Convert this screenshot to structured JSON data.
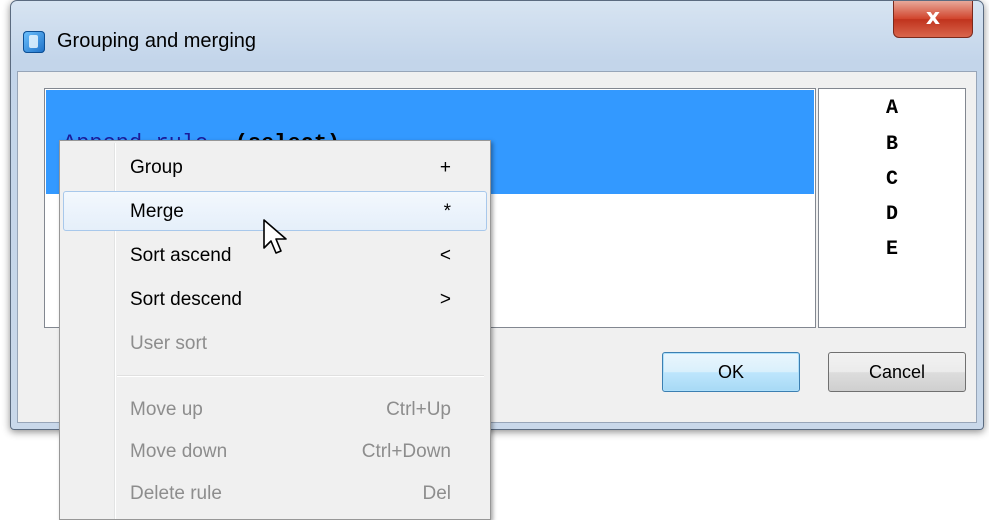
{
  "window": {
    "title": "Grouping and merging",
    "close_glyph": "x"
  },
  "rule_list": {
    "selected_rule_name": "Append rule",
    "selected_rule_arg": "(select)"
  },
  "column_list": {
    "items": [
      "A",
      "B",
      "C",
      "D",
      "E"
    ]
  },
  "buttons": {
    "ok": "OK",
    "cancel": "Cancel"
  },
  "context_menu": {
    "items": [
      {
        "label": "Group",
        "shortcut": "+",
        "enabled": true
      },
      {
        "label": "Merge",
        "shortcut": "*",
        "enabled": true,
        "hovered": true
      },
      {
        "label": "Sort ascend",
        "shortcut": "<",
        "enabled": true
      },
      {
        "label": "Sort descend",
        "shortcut": ">",
        "enabled": true
      },
      {
        "label": "User sort",
        "shortcut": "",
        "enabled": false
      },
      {
        "label": "Move up",
        "shortcut": "Ctrl+Up",
        "enabled": false
      },
      {
        "label": "Move down",
        "shortcut": "Ctrl+Down",
        "enabled": false
      },
      {
        "label": "Delete rule",
        "shortcut": "Del",
        "enabled": false
      }
    ]
  },
  "colors": {
    "selection": "#3399ff",
    "rule_name": "#1c1c9a",
    "close_button": "#c9432c"
  },
  "icons": {
    "app": "app-icon",
    "close": "close-icon",
    "cursor": "mouse-pointer-icon"
  }
}
